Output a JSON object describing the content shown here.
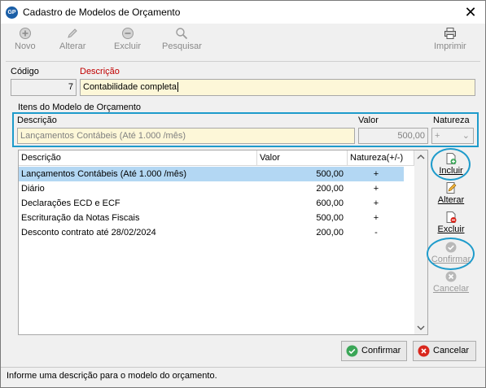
{
  "window": {
    "title": "Cadastro de Modelos de Orçamento",
    "app_icon": "GP",
    "close": "✕"
  },
  "toolbar": {
    "novo": "Novo",
    "alterar": "Alterar",
    "excluir": "Excluir",
    "pesquisar": "Pesquisar",
    "imprimir": "Imprimir"
  },
  "form": {
    "codigo_label": "Código",
    "codigo_value": "7",
    "descricao_label": "Descrição",
    "descricao_value": "Contabilidade completa",
    "group_label": "Itens do Modelo de Orçamento"
  },
  "item_entry": {
    "descricao_label": "Descrição",
    "descricao_value": "Lançamentos Contábeis (Até 1.000 /mês)",
    "valor_label": "Valor",
    "valor_value": "500,00",
    "natureza_label": "Natureza",
    "natureza_value": "+"
  },
  "grid": {
    "columns": [
      "Descrição",
      "Valor",
      "Natureza(+/-)"
    ],
    "rows": [
      {
        "descricao": "Lançamentos Contábeis (Até 1.000 /mês)",
        "valor": "500,00",
        "natureza": "+"
      },
      {
        "descricao": "Diário",
        "valor": "200,00",
        "natureza": "+"
      },
      {
        "descricao": "Declarações ECD e ECF",
        "valor": "600,00",
        "natureza": "+"
      },
      {
        "descricao": "Escrituração da Notas Fiscais",
        "valor": "500,00",
        "natureza": "+"
      },
      {
        "descricao": "Desconto contrato até 28/02/2024",
        "valor": "200,00",
        "natureza": "-"
      }
    ],
    "selected_row": 0
  },
  "side_actions": {
    "incluir": "Incluir",
    "alterar": "Alterar",
    "excluir": "Excluir",
    "confirmar": "Confirmar",
    "cancelar": "Cancelar"
  },
  "bottom_buttons": {
    "confirmar": "Confirmar",
    "cancelar": "Cancelar"
  },
  "status_bar": {
    "text": "Informe uma descrição para o modelo do orçamento."
  },
  "colors": {
    "highlight": "#1e9bcb",
    "required_label": "#c00000",
    "selection": "#b3d7f3",
    "confirm_green": "#3aa657",
    "cancel_red": "#d9261c"
  }
}
